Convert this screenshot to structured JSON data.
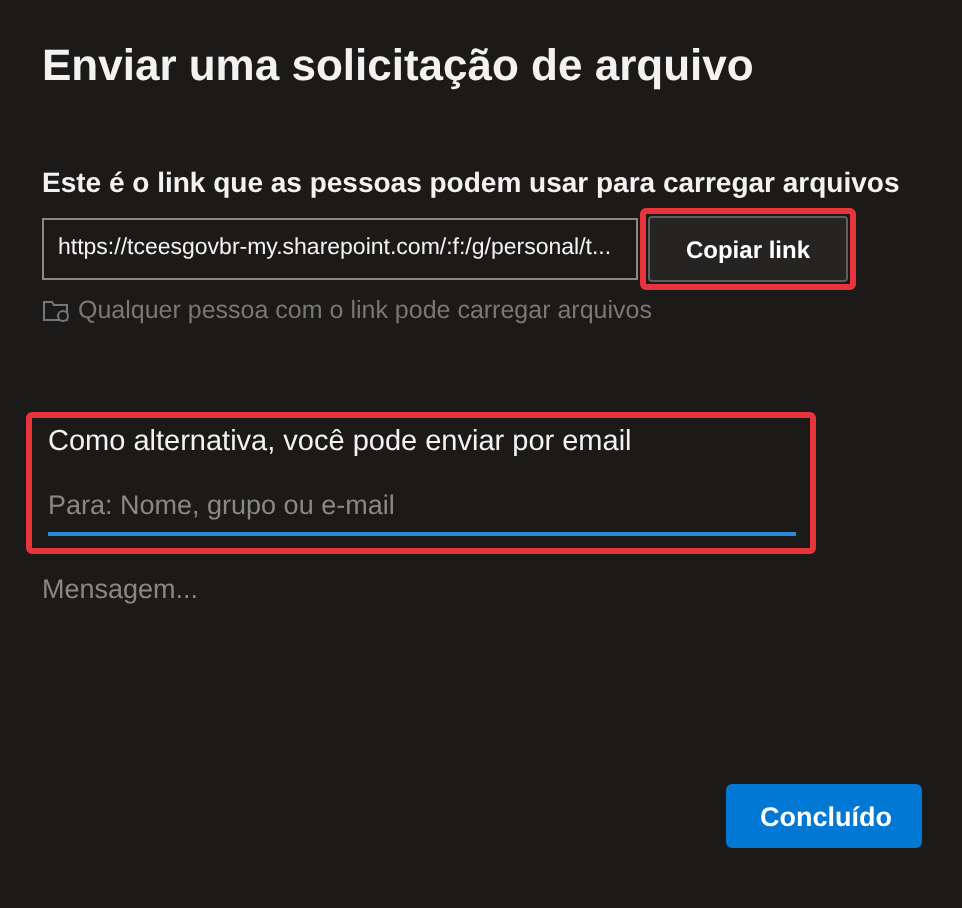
{
  "dialog": {
    "title": "Enviar uma solicitação de arquivo"
  },
  "link_section": {
    "label": "Este é o link que as pessoas podem usar para carregar arquivos",
    "link": "https://tceesgovbr-my.sharepoint.com/:f:/g/personal/t...",
    "copy_button": {
      "label": "Copiar link",
      "highlighted": true
    },
    "note": "Qualquer pessoa com o link pode carregar arquivos"
  },
  "email_section": {
    "label": "Como alternativa, você pode enviar por email",
    "to_field": {
      "placeholder": "Para: Nome, grupo ou e-mail",
      "focused": true
    },
    "highlighted": true
  },
  "message_field": {
    "placeholder": "Mensagem..."
  },
  "buttons": [
    {
      "label": "Concluído",
      "kind": "primary"
    }
  ]
}
